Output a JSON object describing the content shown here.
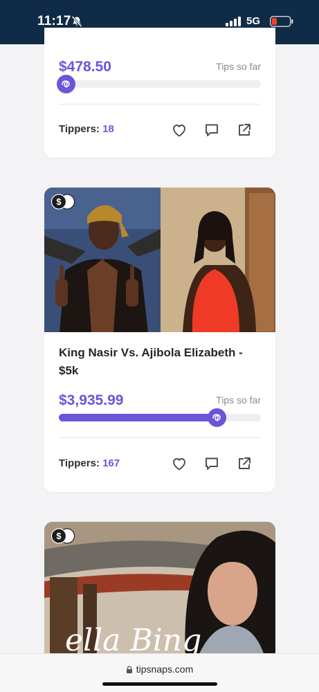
{
  "status_bar": {
    "time": "11:17",
    "network": "5G",
    "icons": [
      "bell-muted-icon",
      "signal-icon",
      "battery-low-icon"
    ]
  },
  "cards": [
    {
      "amount": "$478.50",
      "tips_label": "Tips so far",
      "progress": 0.0,
      "tippers_label": "Tippers:",
      "tippers_count": "18"
    },
    {
      "title": "King Nasir Vs. Ajibola Elizabeth - $5k",
      "amount": "$3,935.99",
      "tips_label": "Tips so far",
      "progress": 0.78,
      "tippers_label": "Tippers:",
      "tippers_count": "167"
    },
    {
      "image_text": "ella Bing"
    }
  ],
  "actions": [
    "heart-icon",
    "comment-icon",
    "share-icon"
  ],
  "browser": {
    "url": "tipsnaps.com"
  },
  "colors": {
    "accent": "#6b55d8",
    "status_bar": "#0f2b46",
    "background": "#f3f3f5"
  }
}
